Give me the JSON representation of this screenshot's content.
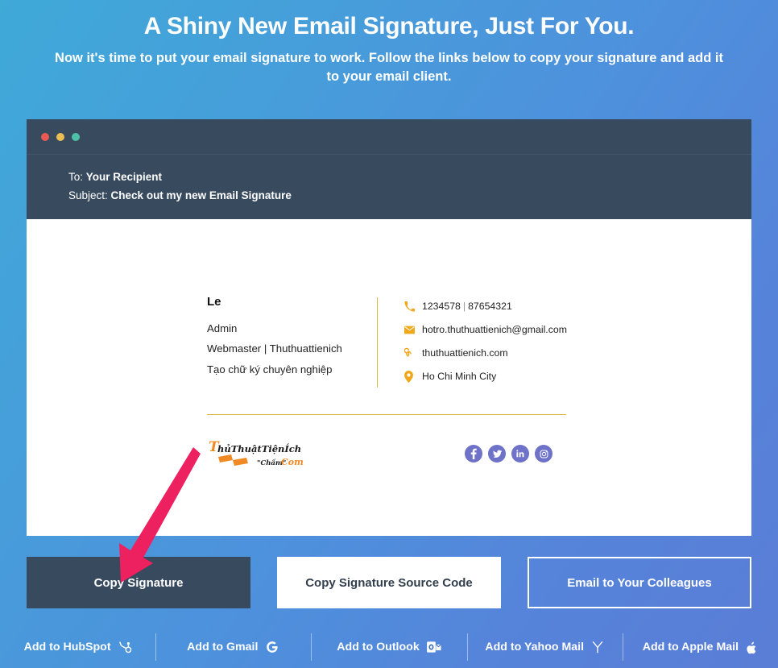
{
  "theme": {
    "bg_gradient_from": "#3fa9d8",
    "bg_gradient_to": "#5a7dd6",
    "dark_panel": "#374a5e",
    "accent_gold": "#d9b942",
    "icon_amber": "#efa71c",
    "social_purple": "#6e72c8",
    "arrow_pink": "#ed2160"
  },
  "hero": {
    "title": "A Shiny New Email Signature, Just For You.",
    "subtitle": "Now it's time to put your email signature to work. Follow the links below to copy your signature and add it to your email client."
  },
  "mail_window": {
    "traffic_lights": [
      "close-red",
      "minimize-yellow",
      "maximize-green"
    ],
    "to_label": "To:",
    "to_value": "Your Recipient",
    "subject_label": "Subject:",
    "subject_value": "Check out my new Email Signature"
  },
  "signature": {
    "name": "Le",
    "lines": [
      "Admin",
      "Webmaster | Thuthuattienich",
      "Tạo chữ ký chuyên nghiệp"
    ],
    "contacts": [
      {
        "icon": "phone-icon",
        "text_primary": "1234578",
        "separator": "|",
        "text_secondary": "87654321"
      },
      {
        "icon": "envelope-icon",
        "text_primary": "hotro.thuthuattienich@gmail.com",
        "separator": "",
        "text_secondary": ""
      },
      {
        "icon": "link-icon",
        "text_primary": "thuthuattienich.com",
        "separator": "",
        "text_secondary": ""
      },
      {
        "icon": "location-pin-icon",
        "text_primary": "Ho Chi Minh City",
        "separator": "",
        "text_secondary": ""
      }
    ],
    "logo": {
      "text_main": "ThủThuậtTiệnÍch",
      "text_sub": "\"Chấm\" Com",
      "color": "#f08a24"
    },
    "socials": [
      {
        "name": "facebook-icon",
        "glyph": "f"
      },
      {
        "name": "twitter-icon",
        "glyph": "t"
      },
      {
        "name": "linkedin-icon",
        "glyph": "in"
      },
      {
        "name": "instagram-icon",
        "glyph": "ig"
      }
    ]
  },
  "actions": [
    {
      "label": "Copy Signature",
      "style": "dark"
    },
    {
      "label": "Copy Signature Source Code",
      "style": "white"
    },
    {
      "label": "Email to Your Colleagues",
      "style": "ghost"
    }
  ],
  "bottom_links": [
    {
      "label": "Add to HubSpot",
      "icon": "hubspot-icon"
    },
    {
      "label": "Add to Gmail",
      "icon": "google-g-icon"
    },
    {
      "label": "Add to Outlook",
      "icon": "outlook-icon"
    },
    {
      "label": "Add to Yahoo Mail",
      "icon": "yahoo-y-icon"
    },
    {
      "label": "Add to Apple Mail",
      "icon": "apple-icon"
    }
  ],
  "annotation": {
    "type": "arrow",
    "points_to": "Copy Signature",
    "color": "#ed2160"
  }
}
